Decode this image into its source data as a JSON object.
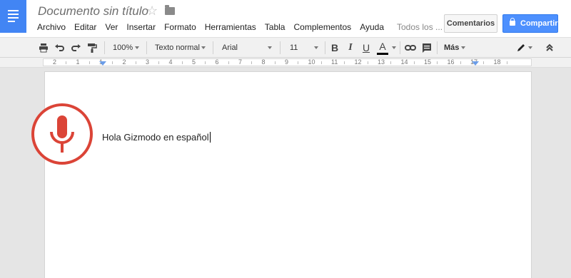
{
  "header": {
    "document_title": "Documento sin título",
    "icons": [
      "docs-menu-icon",
      "star-icon",
      "folder-icon"
    ],
    "menu": [
      "Archivo",
      "Editar",
      "Ver",
      "Insertar",
      "Formato",
      "Herramientas",
      "Tabla",
      "Complementos",
      "Ayuda",
      "Todos los ..."
    ],
    "comments_label": "Comentarios",
    "share_label": "Compartir",
    "accent_color": "#4285f4"
  },
  "toolbar": {
    "zoom": "100%",
    "style": "Texto normal",
    "font": "Arial",
    "size": "11",
    "more_label": "Más",
    "bold_label": "B",
    "italic_label": "I",
    "underline_label": "U",
    "color_label": "A"
  },
  "ruler": {
    "numbers": [
      "2",
      "1",
      "1",
      "2",
      "3",
      "4",
      "5",
      "6",
      "7",
      "8",
      "9",
      "10",
      "11",
      "12",
      "13",
      "14",
      "15",
      "16",
      "17",
      "18"
    ]
  },
  "document": {
    "text": "Hola Gizmodo en español"
  },
  "voice_input": {
    "icon": "microphone-icon",
    "color": "#db4437"
  }
}
